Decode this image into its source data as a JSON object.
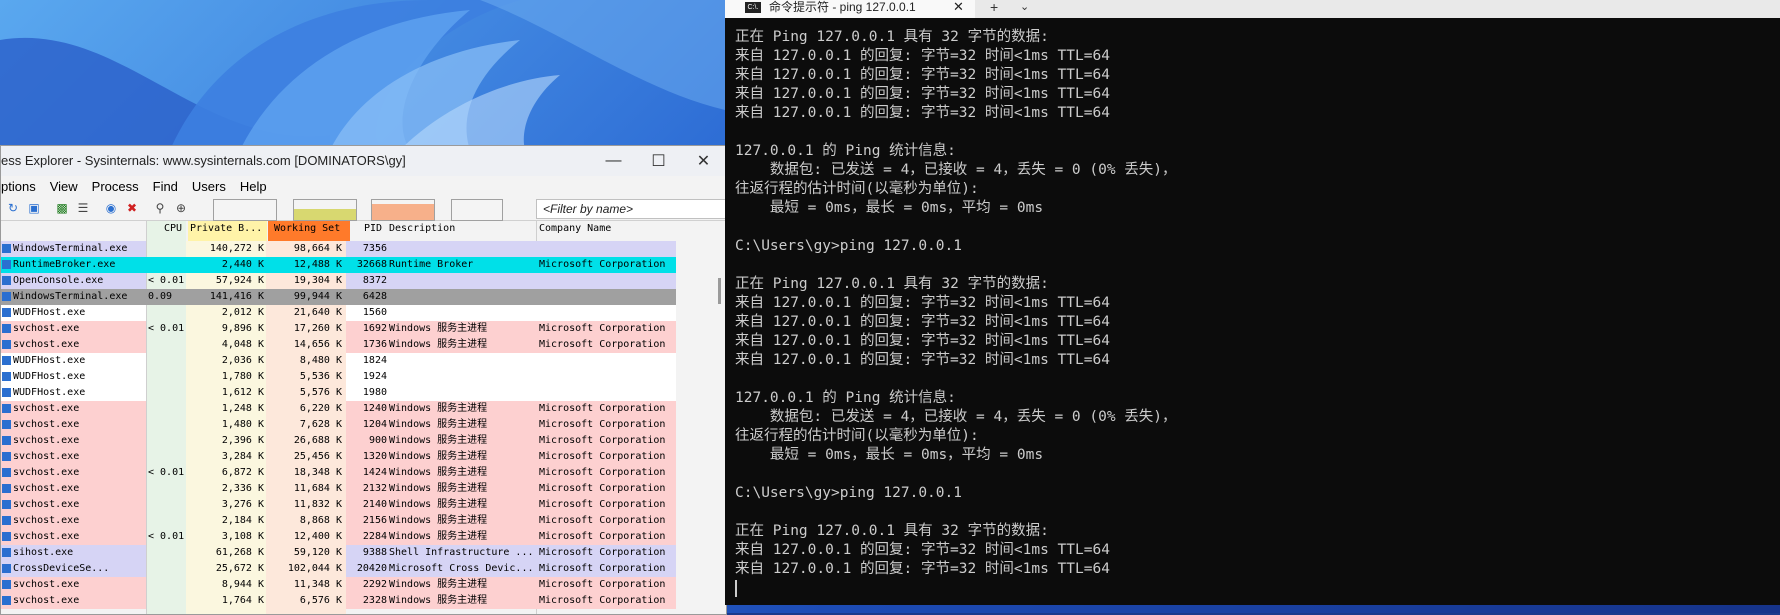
{
  "procexp": {
    "title": "ess Explorer - Sysinternals: www.sysinternals.com [DOMINATORS\\gy]",
    "menu": [
      "ptions",
      "View",
      "Process",
      "Find",
      "Users",
      "Help"
    ],
    "filter_placeholder": "<Filter by name>",
    "columns": {
      "cpu": "CPU",
      "private": "Private B...",
      "working": "Working Set",
      "pid": "PID",
      "description": "Description",
      "company": "Company Name"
    },
    "rows": [
      {
        "name": "WindowsTerminal.exe",
        "cpu": "",
        "priv": "140,272 K",
        "ws": "98,664 K",
        "pid": "7356",
        "desc": "",
        "company": "",
        "bg": "#d6d4f5"
      },
      {
        "name": "RuntimeBroker.exe",
        "cpu": "",
        "priv": "2,440 K",
        "ws": "12,488 K",
        "pid": "32668",
        "desc": "Runtime Broker",
        "company": "Microsoft Corporation",
        "bg": "#00e0e8"
      },
      {
        "name": "OpenConsole.exe",
        "cpu": "< 0.01",
        "priv": "57,924 K",
        "ws": "19,304 K",
        "pid": "8372",
        "desc": "",
        "company": "",
        "bg": "#d6d4f5"
      },
      {
        "name": "WindowsTerminal.exe",
        "cpu": "0.09",
        "priv": "141,416 K",
        "ws": "99,944 K",
        "pid": "6428",
        "desc": "",
        "company": "",
        "bg": "#a0a0a0"
      },
      {
        "name": "WUDFHost.exe",
        "cpu": "",
        "priv": "2,012 K",
        "ws": "21,640 K",
        "pid": "1560",
        "desc": "",
        "company": "",
        "bg": "#ffffff"
      },
      {
        "name": "svchost.exe",
        "cpu": "< 0.01",
        "priv": "9,896 K",
        "ws": "17,260 K",
        "pid": "1692",
        "desc": "Windows 服务主进程",
        "company": "Microsoft Corporation",
        "bg": "#fdd0d0"
      },
      {
        "name": "svchost.exe",
        "cpu": "",
        "priv": "4,048 K",
        "ws": "14,656 K",
        "pid": "1736",
        "desc": "Windows 服务主进程",
        "company": "Microsoft Corporation",
        "bg": "#fdd0d0"
      },
      {
        "name": "WUDFHost.exe",
        "cpu": "",
        "priv": "2,036 K",
        "ws": "8,480 K",
        "pid": "1824",
        "desc": "",
        "company": "",
        "bg": "#ffffff"
      },
      {
        "name": "WUDFHost.exe",
        "cpu": "",
        "priv": "1,780 K",
        "ws": "5,536 K",
        "pid": "1924",
        "desc": "",
        "company": "",
        "bg": "#ffffff"
      },
      {
        "name": "WUDFHost.exe",
        "cpu": "",
        "priv": "1,612 K",
        "ws": "5,576 K",
        "pid": "1980",
        "desc": "",
        "company": "",
        "bg": "#ffffff"
      },
      {
        "name": "svchost.exe",
        "cpu": "",
        "priv": "1,248 K",
        "ws": "6,220 K",
        "pid": "1240",
        "desc": "Windows 服务主进程",
        "company": "Microsoft Corporation",
        "bg": "#fdd0d0"
      },
      {
        "name": "svchost.exe",
        "cpu": "",
        "priv": "1,480 K",
        "ws": "7,628 K",
        "pid": "1204",
        "desc": "Windows 服务主进程",
        "company": "Microsoft Corporation",
        "bg": "#fdd0d0"
      },
      {
        "name": "svchost.exe",
        "cpu": "",
        "priv": "2,396 K",
        "ws": "26,688 K",
        "pid": "900",
        "desc": "Windows 服务主进程",
        "company": "Microsoft Corporation",
        "bg": "#fdd0d0"
      },
      {
        "name": "svchost.exe",
        "cpu": "",
        "priv": "3,284 K",
        "ws": "25,456 K",
        "pid": "1320",
        "desc": "Windows 服务主进程",
        "company": "Microsoft Corporation",
        "bg": "#fdd0d0"
      },
      {
        "name": "svchost.exe",
        "cpu": "< 0.01",
        "priv": "6,872 K",
        "ws": "18,348 K",
        "pid": "1424",
        "desc": "Windows 服务主进程",
        "company": "Microsoft Corporation",
        "bg": "#fdd0d0"
      },
      {
        "name": "svchost.exe",
        "cpu": "",
        "priv": "2,336 K",
        "ws": "11,684 K",
        "pid": "2132",
        "desc": "Windows 服务主进程",
        "company": "Microsoft Corporation",
        "bg": "#fdd0d0"
      },
      {
        "name": "svchost.exe",
        "cpu": "",
        "priv": "3,276 K",
        "ws": "11,832 K",
        "pid": "2140",
        "desc": "Windows 服务主进程",
        "company": "Microsoft Corporation",
        "bg": "#fdd0d0"
      },
      {
        "name": "svchost.exe",
        "cpu": "",
        "priv": "2,184 K",
        "ws": "8,868 K",
        "pid": "2156",
        "desc": "Windows 服务主进程",
        "company": "Microsoft Corporation",
        "bg": "#fdd0d0"
      },
      {
        "name": "svchost.exe",
        "cpu": "< 0.01",
        "priv": "3,108 K",
        "ws": "12,400 K",
        "pid": "2284",
        "desc": "Windows 服务主进程",
        "company": "Microsoft Corporation",
        "bg": "#fdd0d0"
      },
      {
        "name": "sihost.exe",
        "cpu": "",
        "priv": "61,268 K",
        "ws": "59,120 K",
        "pid": "9388",
        "desc": "Shell Infrastructure ...",
        "company": "Microsoft Corporation",
        "bg": "#d6d4f5"
      },
      {
        "name": "CrossDeviceSe...",
        "cpu": "",
        "priv": "25,672 K",
        "ws": "102,044 K",
        "pid": "20420",
        "desc": "Microsoft Cross Devic...",
        "company": "Microsoft Corporation",
        "bg": "#d6d4f5"
      },
      {
        "name": "svchost.exe",
        "cpu": "",
        "priv": "8,944 K",
        "ws": "11,348 K",
        "pid": "2292",
        "desc": "Windows 服务主进程",
        "company": "Microsoft Corporation",
        "bg": "#fdd0d0"
      },
      {
        "name": "svchost.exe",
        "cpu": "",
        "priv": "1,764 K",
        "ws": "6,576 K",
        "pid": "2328",
        "desc": "Windows 服务主进程",
        "company": "Microsoft Corporation",
        "bg": "#fdd0d0"
      }
    ]
  },
  "terminal": {
    "tab_title": "命令提示符 - ping  127.0.0.1",
    "tab_icon_text": "C:\\.",
    "new_tab": "+",
    "dropdown": "⌄",
    "lines": [
      "正在 Ping 127.0.0.1 具有 32 字节的数据:",
      "来自 127.0.0.1 的回复: 字节=32 时间<1ms TTL=64",
      "来自 127.0.0.1 的回复: 字节=32 时间<1ms TTL=64",
      "来自 127.0.0.1 的回复: 字节=32 时间<1ms TTL=64",
      "来自 127.0.0.1 的回复: 字节=32 时间<1ms TTL=64",
      "",
      "127.0.0.1 的 Ping 统计信息:",
      "    数据包: 已发送 = 4，已接收 = 4，丢失 = 0 (0% 丢失)，",
      "往返行程的估计时间(以毫秒为单位):",
      "    最短 = 0ms，最长 = 0ms，平均 = 0ms",
      "",
      "C:\\Users\\gy>ping 127.0.0.1",
      "",
      "正在 Ping 127.0.0.1 具有 32 字节的数据:",
      "来自 127.0.0.1 的回复: 字节=32 时间<1ms TTL=64",
      "来自 127.0.0.1 的回复: 字节=32 时间<1ms TTL=64",
      "来自 127.0.0.1 的回复: 字节=32 时间<1ms TTL=64",
      "来自 127.0.0.1 的回复: 字节=32 时间<1ms TTL=64",
      "",
      "127.0.0.1 的 Ping 统计信息:",
      "    数据包: 已发送 = 4，已接收 = 4，丢失 = 0 (0% 丢失)，",
      "往返行程的估计时间(以毫秒为单位):",
      "    最短 = 0ms，最长 = 0ms，平均 = 0ms",
      "",
      "C:\\Users\\gy>ping 127.0.0.1",
      "",
      "正在 Ping 127.0.0.1 具有 32 字节的数据:",
      "来自 127.0.0.1 的回复: 字节=32 时间<1ms TTL=64",
      "来自 127.0.0.1 的回复: 字节=32 时间<1ms TTL=64"
    ]
  }
}
